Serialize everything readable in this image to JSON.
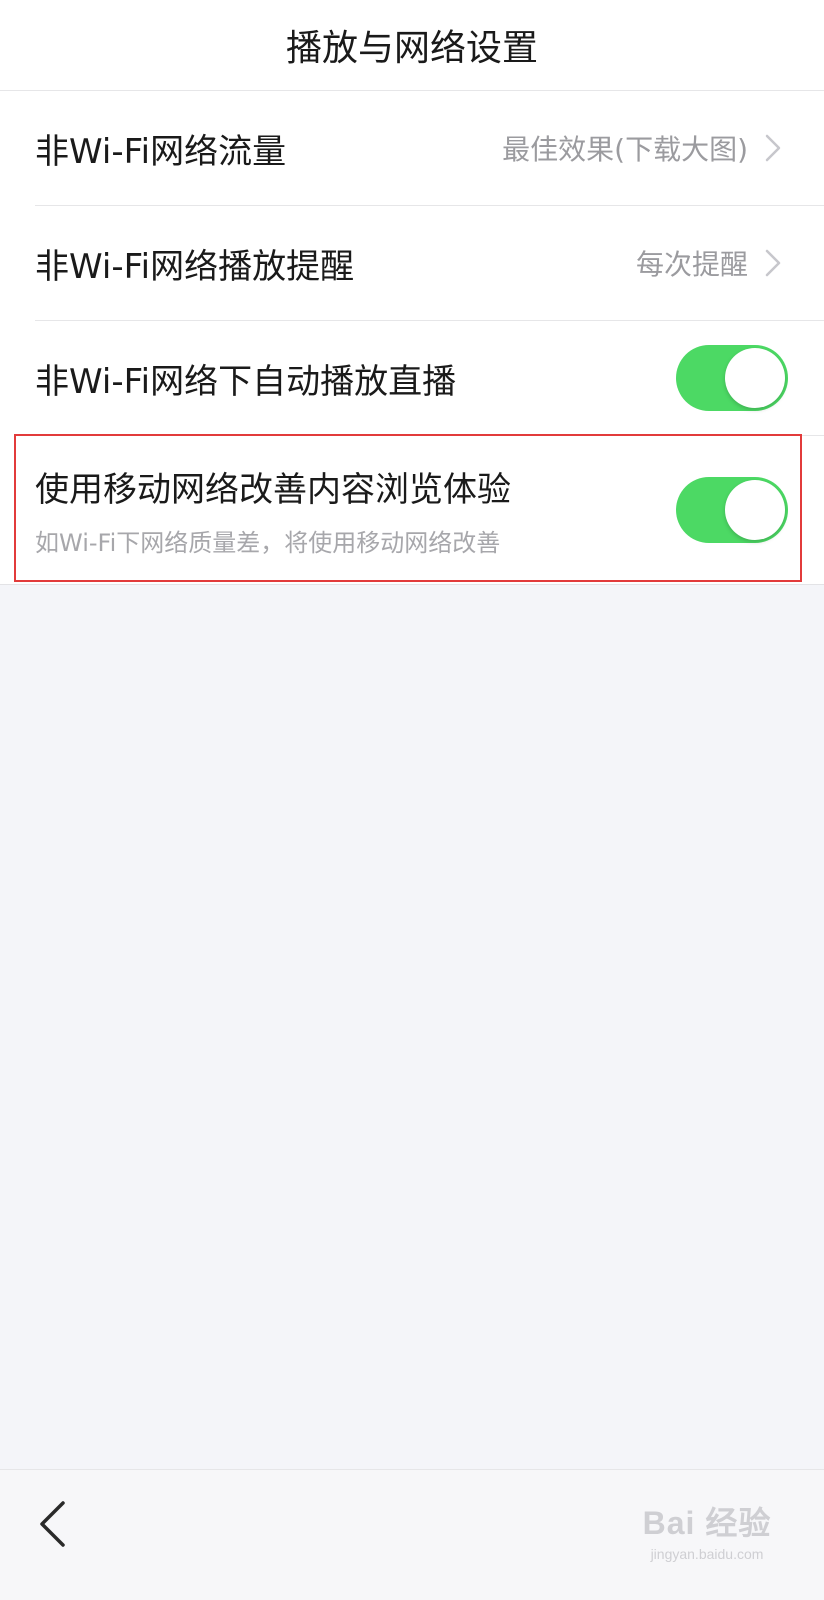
{
  "header": {
    "title": "播放与网络设置"
  },
  "settings": [
    {
      "label": "非Wi-Fi网络流量",
      "value": "最佳效果(下载大图)"
    },
    {
      "label": "非Wi-Fi网络播放提醒",
      "value": "每次提醒"
    },
    {
      "label": "非Wi-Fi网络下自动播放直播",
      "toggle_on": true
    },
    {
      "label": "使用移动网络改善内容浏览体验",
      "sublabel": "如Wi-Fi下网络质量差，将使用移动网络改善",
      "toggle_on": true
    }
  ],
  "footer": {
    "back_icon": "chevron-left-icon",
    "watermark_brand": "Bai 经验",
    "watermark_url": "jingyan.baidu.com"
  },
  "colors": {
    "toggle_on": "#4cd964",
    "highlight": "#e23b3b",
    "background": "#f4f5f9"
  }
}
